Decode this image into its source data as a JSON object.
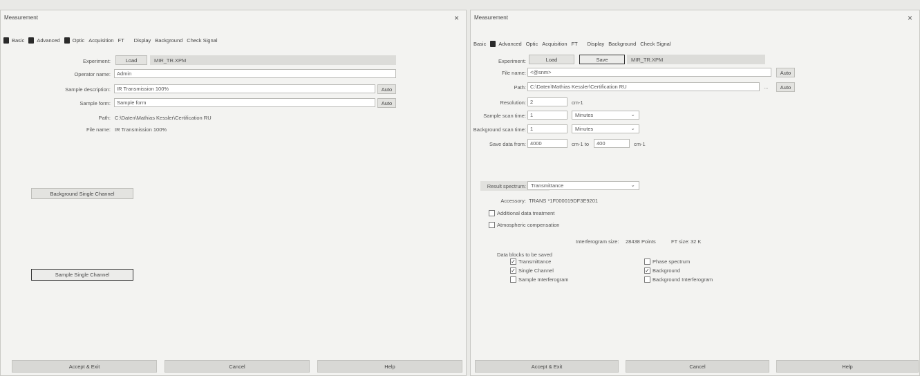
{
  "left": {
    "title": "Measurement",
    "close": "×",
    "tabs": [
      "Basic",
      "Advanced",
      "Optic",
      "Acquisition",
      "FT",
      "Display",
      "Background",
      "Check Signal"
    ],
    "experiment_label": "Experiment:",
    "load_label": "Load",
    "experiment_file": "MIR_TR.XPM",
    "operator_label": "Operator name:",
    "operator_value": "Admin",
    "sample_desc_label": "Sample description:",
    "sample_desc_value": "IR Transmission 100%",
    "sample_form_label": "Sample form:",
    "sample_form_value": "Sample form",
    "auto_label": "Auto",
    "path_label": "Path:",
    "path_value": "C:\\Daten\\Mathias Kessler\\Certification RU",
    "filename_label": "File name:",
    "filename_value": "IR Transmission 100%",
    "bg_single_channel": "Background Single Channel",
    "sample_single_channel": "Sample Single Channel",
    "accept_exit": "Accept & Exit",
    "cancel": "Cancel",
    "help": "Help"
  },
  "right": {
    "title": "Measurement",
    "close": "×",
    "tabs": [
      "Basic",
      "Advanced",
      "Optic",
      "Acquisition",
      "FT",
      "Display",
      "Background",
      "Check Signal"
    ],
    "experiment_label": "Experiment:",
    "load_label": "Load",
    "save_label": "Save",
    "experiment_file": "MIR_TR.XPM",
    "filename_label": "File name:",
    "filename_value": "<@snm>",
    "auto_label": "Auto",
    "path_label": "Path:",
    "path_value": "C:\\Daten\\Mathias Kessler\\Certification RU",
    "browse_label": "...",
    "resolution_label": "Resolution:",
    "resolution_value": "2",
    "resolution_unit": "cm-1",
    "sample_scan_label": "Sample scan time:",
    "sample_scan_value": "1",
    "sample_scan_unit": "Minutes",
    "bg_scan_label": "Background scan time:",
    "bg_scan_value": "1",
    "bg_scan_unit": "Minutes",
    "save_from_label": "Save data from:",
    "save_from_value": "4000",
    "save_from_unit": "cm-1 to",
    "save_to_value": "400",
    "save_to_unit": "cm-1",
    "result_spectrum_label": "Result spectrum:",
    "result_spectrum_value": "Transmittance",
    "accessory_label": "Accessory:",
    "accessory_value": "TRANS *1F000019DF3E9201",
    "additional_treatment": "Additional data treatment",
    "atmospheric_comp": "Atmospheric compensation",
    "interferogram_size_label": "Interferogram size:",
    "interferogram_size_value": "28438 Points",
    "ft_size_label": "FT size:",
    "ft_size_value": "32 K",
    "data_blocks_label": "Data blocks to be saved",
    "blocks": [
      {
        "label": "Transmittance",
        "checked": true
      },
      {
        "label": "Single Channel",
        "checked": true
      },
      {
        "label": "Sample Interferogram",
        "checked": false
      },
      {
        "label": "Phase spectrum",
        "checked": false
      },
      {
        "label": "Background",
        "checked": true
      },
      {
        "label": "Background Interferogram",
        "checked": false
      }
    ],
    "accept_exit": "Accept & Exit",
    "cancel": "Cancel",
    "help": "Help"
  }
}
